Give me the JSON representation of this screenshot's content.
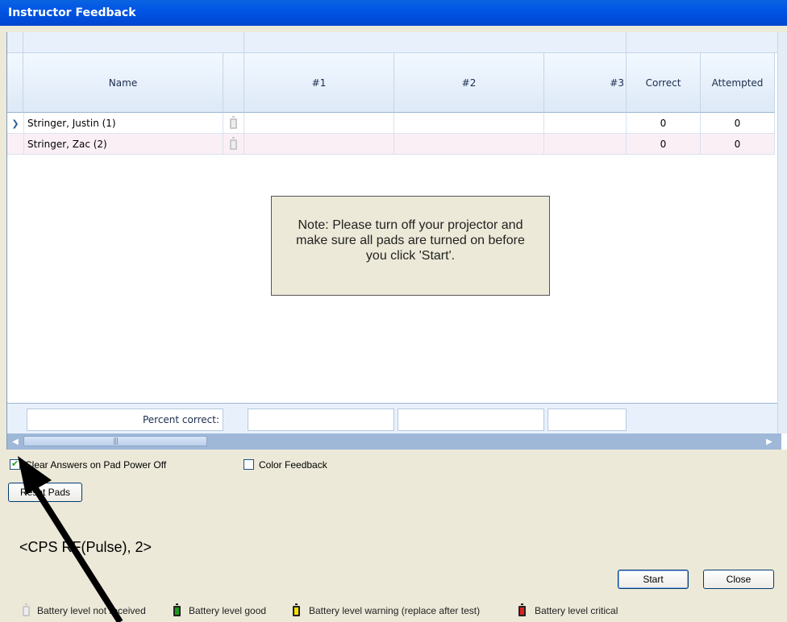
{
  "window": {
    "title": "Instructor Feedback"
  },
  "grid": {
    "headers": {
      "name": "Name",
      "q1": "#1",
      "q2": "#2",
      "q3": "#3",
      "correct": "Correct",
      "attempted": "Attempted"
    },
    "rows": [
      {
        "name": "Stringer, Justin (1)",
        "correct": "0",
        "attempted": "0"
      },
      {
        "name": "Stringer, Zac (2)",
        "correct": "0",
        "attempted": "0"
      }
    ],
    "percent_label": "Percent correct:"
  },
  "note": {
    "text": "Note: Please turn off your projector and make sure all pads are turned on before you click 'Start'."
  },
  "options": {
    "clear_answers": {
      "label": "Clear Answers on Pad Power Off",
      "checked": true
    },
    "color_feedback": {
      "label": "Color Feedback",
      "checked": false
    }
  },
  "buttons": {
    "reset_pads": "Reset Pads",
    "start": "Start",
    "close": "Close"
  },
  "connection": {
    "text": "<CPS RF(Pulse), 2>"
  },
  "legend": {
    "not_received": "Battery level not received",
    "good": "Battery level good",
    "warning": "Battery level warning (replace after test)",
    "critical": "Battery level critical"
  },
  "colors": {
    "title_bar": "#0055e5",
    "battery_good": "#1e9a1e",
    "battery_warning": "#f2e000",
    "battery_critical": "#e02020"
  }
}
